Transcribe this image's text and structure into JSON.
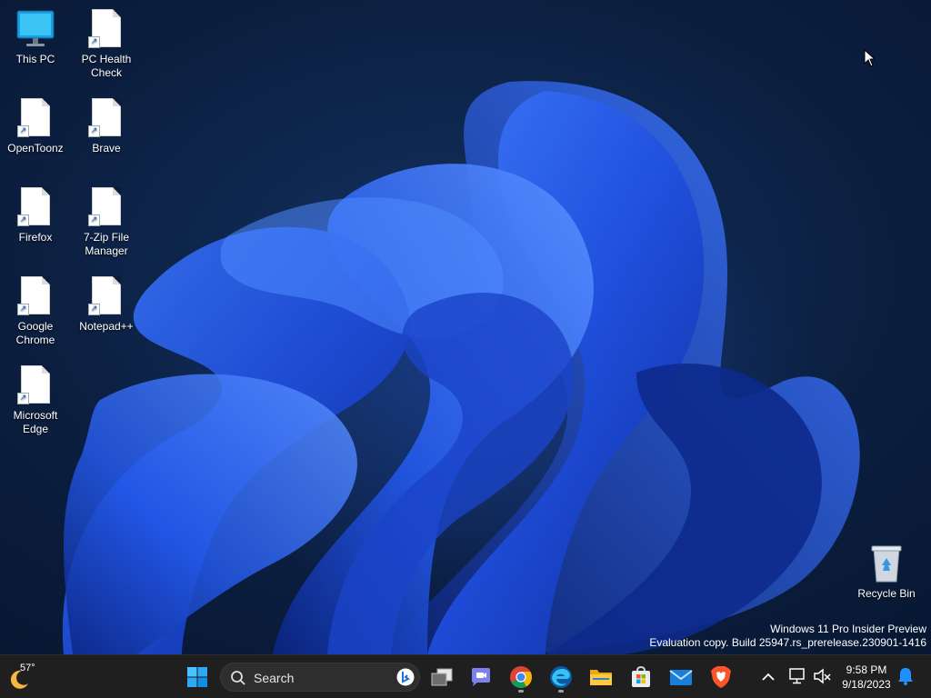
{
  "desktop": {
    "icons": [
      {
        "label": "This PC",
        "icon": "this-pc-icon"
      },
      {
        "label": "PC Health Check",
        "icon": "file-shortcut-icon"
      },
      {
        "label": "OpenToonz",
        "icon": "file-shortcut-icon"
      },
      {
        "label": "Brave",
        "icon": "file-shortcut-icon"
      },
      {
        "label": "Firefox",
        "icon": "file-shortcut-icon"
      },
      {
        "label": "7-Zip File Manager",
        "icon": "file-shortcut-icon"
      },
      {
        "label": "Google Chrome",
        "icon": "file-shortcut-icon"
      },
      {
        "label": "Notepad++",
        "icon": "file-shortcut-icon"
      },
      {
        "label": "Microsoft Edge",
        "icon": "file-shortcut-icon"
      }
    ],
    "recycle_bin": {
      "label": "Recycle Bin",
      "icon": "recycle-bin-icon"
    },
    "watermark": {
      "line1": "Windows 11 Pro Insider Preview",
      "line2": "Evaluation copy. Build 25947.rs_prerelease.230901-1416"
    }
  },
  "taskbar": {
    "weather": {
      "temp": "57°",
      "icon": "weather-moon-icon"
    },
    "search": {
      "placeholder": "Search"
    },
    "apps": [
      {
        "name": "Start",
        "icon": "windows-start-icon"
      },
      {
        "name": "Task View",
        "icon": "task-view-icon"
      },
      {
        "name": "Teams Chat",
        "icon": "teams-chat-icon"
      },
      {
        "name": "Google Chrome",
        "icon": "chrome-icon",
        "running": true
      },
      {
        "name": "Microsoft Edge",
        "icon": "edge-icon",
        "running": true
      },
      {
        "name": "File Explorer",
        "icon": "file-explorer-icon"
      },
      {
        "name": "Microsoft Store",
        "icon": "store-icon"
      },
      {
        "name": "Mail",
        "icon": "mail-icon"
      },
      {
        "name": "Brave",
        "icon": "brave-icon"
      }
    ],
    "tray": {
      "time": "9:58 PM",
      "date": "9/18/2023",
      "icons": [
        "chevron-up-icon",
        "network-icon",
        "volume-muted-icon",
        "notification-bell-icon"
      ]
    }
  },
  "colors": {
    "taskbar_bg": "#1f1f1f",
    "accent": "#0078d4",
    "wallpaper_bloom": "#2a5cf0"
  }
}
